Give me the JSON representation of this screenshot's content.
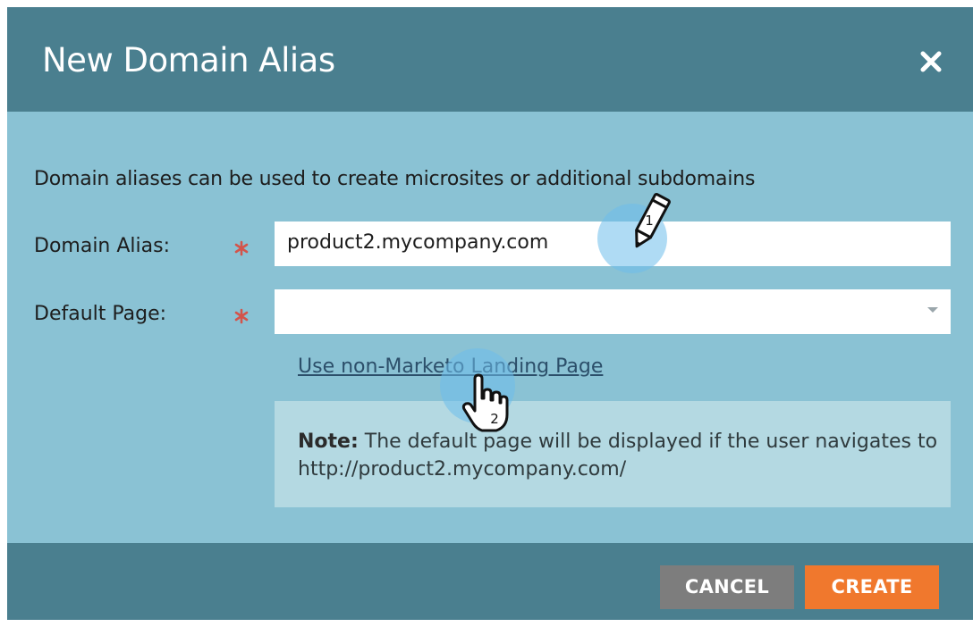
{
  "dialog": {
    "title": "New Domain Alias",
    "close_icon": "close-icon",
    "description": "Domain aliases can be used to create microsites or additional subdomains",
    "fields": {
      "domain_alias": {
        "label": "Domain Alias:",
        "value": "product2.mycompany.com"
      },
      "default_page": {
        "label": "Default Page:",
        "value": ""
      }
    },
    "link_label": "Use non-Marketo Landing Page",
    "note": {
      "bold": "Note:",
      "text": " The default page will be displayed if the user navigates to http://product2.mycompany.com/"
    },
    "buttons": {
      "cancel": "CANCEL",
      "create": "CREATE"
    }
  },
  "callouts": [
    {
      "number": "1",
      "icon": "pencil-icon"
    },
    {
      "number": "2",
      "icon": "hand-pointer-icon"
    }
  ],
  "colors": {
    "header": "#4a7f8f",
    "body": "#8ac2d4",
    "note": "#b4d9e2",
    "cancel": "#7d7d7d",
    "create": "#f0782d",
    "required": "#c8473f"
  }
}
